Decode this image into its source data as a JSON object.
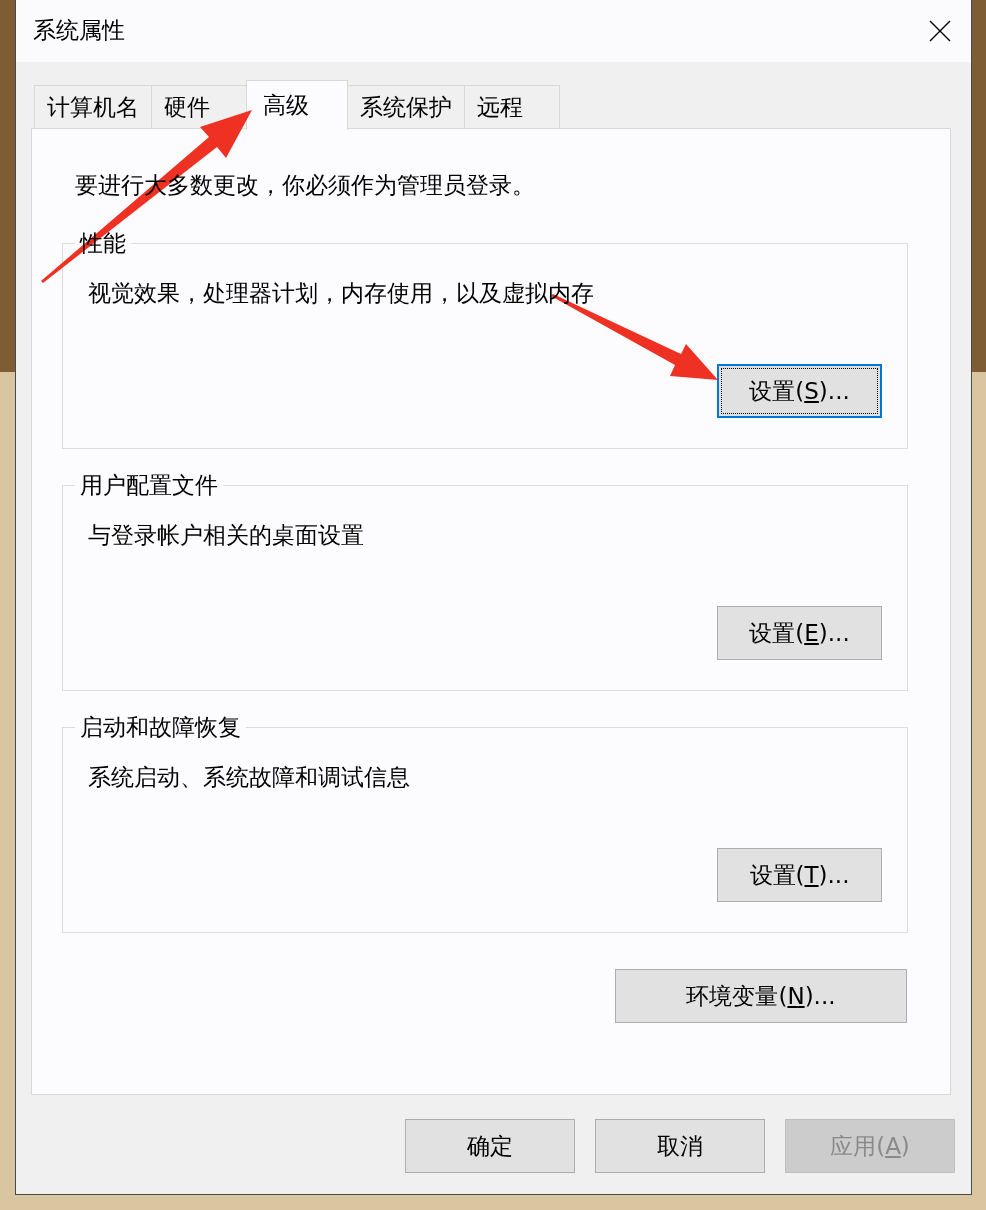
{
  "window": {
    "title": "系统属性"
  },
  "tabs": [
    {
      "label": "计算机名",
      "selected": false
    },
    {
      "label": "硬件",
      "selected": false
    },
    {
      "label": "高级",
      "selected": true
    },
    {
      "label": "系统保护",
      "selected": false
    },
    {
      "label": "远程",
      "selected": false
    }
  ],
  "notice": "要进行大多数更改，你必须作为管理员登录。",
  "groups": [
    {
      "title": "性能",
      "description": "视觉效果，处理器计划，内存使用，以及虚拟内存",
      "button": {
        "label": "设置(",
        "access_key": "S",
        "label_end": ")...",
        "focused": true
      }
    },
    {
      "title": "用户配置文件",
      "description": "与登录帐户相关的桌面设置",
      "button": {
        "label": "设置(",
        "access_key": "E",
        "label_end": ")...",
        "focused": false
      }
    },
    {
      "title": "启动和故障恢复",
      "description": "系统启动、系统故障和调试信息",
      "button": {
        "label": "设置(",
        "access_key": "T",
        "label_end": ")...",
        "focused": false
      }
    }
  ],
  "environment_button": {
    "label": "环境变量(",
    "access_key": "N",
    "label_end": ")..."
  },
  "dialog_buttons": [
    {
      "label": "确定",
      "disabled": false
    },
    {
      "label": "取消",
      "disabled": false
    },
    {
      "label": "应用(",
      "access_key": "A",
      "label_end": ")",
      "disabled": true
    }
  ]
}
